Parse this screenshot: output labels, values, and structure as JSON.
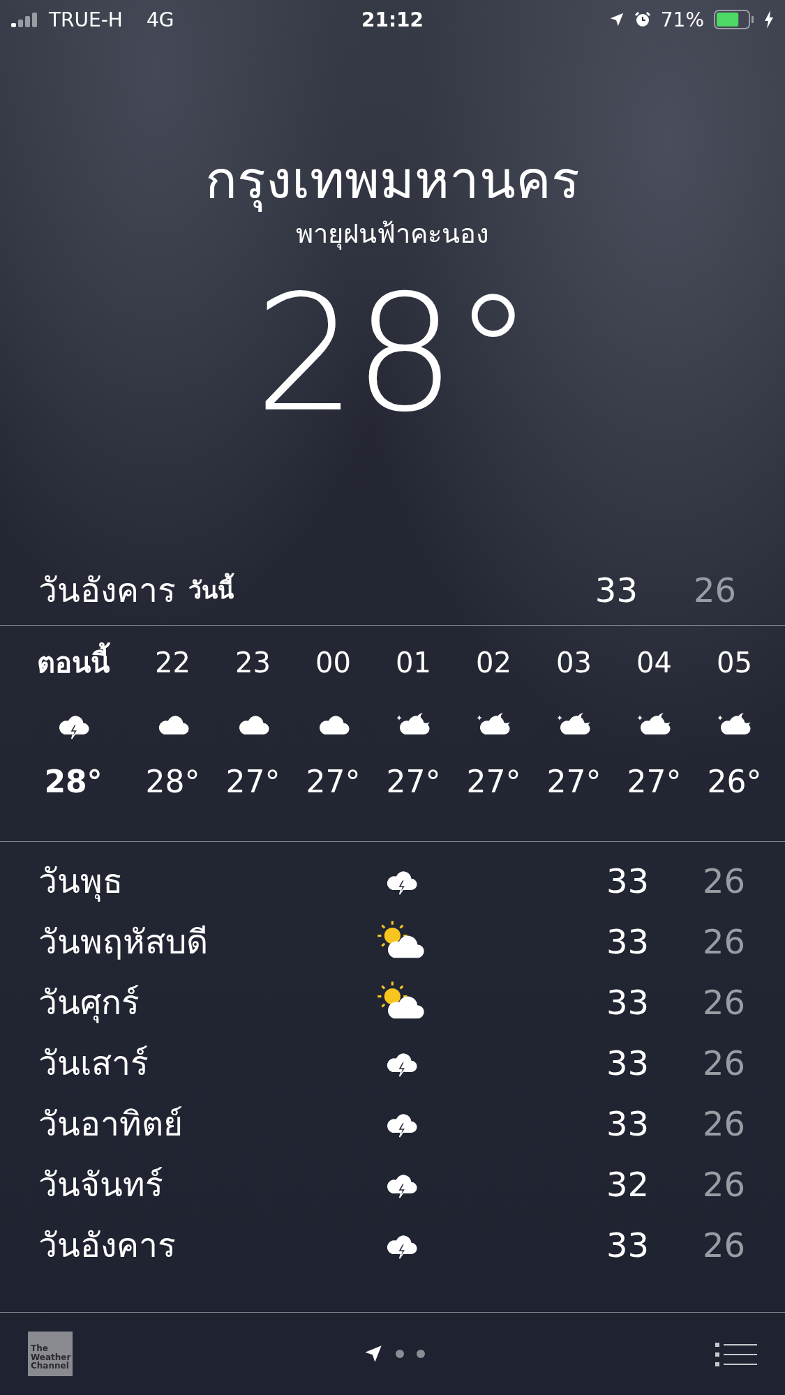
{
  "status_bar": {
    "carrier": "TRUE-H",
    "network": "4G",
    "time": "21:12",
    "battery_text": "71%",
    "battery": {
      "level": 0.71
    },
    "charging": true
  },
  "location": {
    "city": "กรุงเทพมหานคร",
    "condition": "พายุฝนฟ้าคะนอง",
    "temperature": "28°"
  },
  "today": {
    "day": "วันอังคาร",
    "label": "วันนี้",
    "high": "33",
    "low": "26"
  },
  "hourly": [
    {
      "time": "ตอนนี้",
      "kind": "thunder",
      "temp": "28°",
      "now": true
    },
    {
      "time": "22",
      "kind": "cloud",
      "temp": "28°",
      "now": false
    },
    {
      "time": "23",
      "kind": "cloud",
      "temp": "27°",
      "now": false
    },
    {
      "time": "00",
      "kind": "cloud",
      "temp": "27°",
      "now": false
    },
    {
      "time": "01",
      "kind": "night-cloud",
      "temp": "27°",
      "now": false
    },
    {
      "time": "02",
      "kind": "night-cloud",
      "temp": "27°",
      "now": false
    },
    {
      "time": "03",
      "kind": "night-cloud",
      "temp": "27°",
      "now": false
    },
    {
      "time": "04",
      "kind": "night-cloud",
      "temp": "27°",
      "now": false
    },
    {
      "time": "05",
      "kind": "night-cloud",
      "temp": "26°",
      "now": false
    }
  ],
  "daily": [
    {
      "day": "วันพุธ",
      "kind": "thunder",
      "high": "33",
      "low": "26"
    },
    {
      "day": "วันพฤหัสบดี",
      "kind": "sun-cloud",
      "high": "33",
      "low": "26"
    },
    {
      "day": "วันศุกร์",
      "kind": "sun-cloud",
      "high": "33",
      "low": "26"
    },
    {
      "day": "วันเสาร์",
      "kind": "thunder",
      "high": "33",
      "low": "26"
    },
    {
      "day": "วันอาทิตย์",
      "kind": "thunder",
      "high": "33",
      "low": "26"
    },
    {
      "day": "วันจันทร์",
      "kind": "thunder",
      "high": "32",
      "low": "26"
    },
    {
      "day": "วันอังคาร",
      "kind": "thunder",
      "high": "33",
      "low": "26"
    }
  ],
  "bottom_bar": {
    "logo": "The Weather Channel",
    "pages": [
      {
        "kind": "location",
        "selected": true
      },
      {
        "kind": "dot",
        "selected": false
      },
      {
        "kind": "dot",
        "selected": false
      }
    ]
  }
}
